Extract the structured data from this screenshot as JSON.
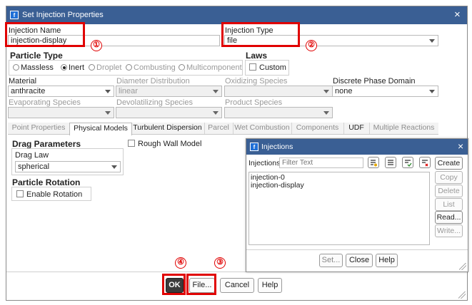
{
  "main_window": {
    "title": "Set Injection Properties",
    "close_glyph": "×",
    "app_icon_glyph": "f"
  },
  "injection_name": {
    "label": "Injection Name",
    "value": "injection-display"
  },
  "injection_type": {
    "label": "Injection Type",
    "value": "file"
  },
  "particle_type": {
    "label": "Particle Type",
    "options": [
      "Massless",
      "Inert",
      "Droplet",
      "Combusting",
      "Multicomponent"
    ],
    "selected": "Inert"
  },
  "laws": {
    "label": "Laws",
    "custom_label": "Custom"
  },
  "material": {
    "label": "Material",
    "value": "anthracite"
  },
  "diameter_distribution": {
    "label": "Diameter Distribution",
    "value": "linear"
  },
  "oxidizing_species": {
    "label": "Oxidizing Species",
    "value": ""
  },
  "discrete_phase_domain": {
    "label": "Discrete Phase Domain",
    "value": "none"
  },
  "evaporating_species": {
    "label": "Evaporating Species",
    "value": ""
  },
  "devolatilizing_species": {
    "label": "Devolatilizing Species",
    "value": ""
  },
  "product_species": {
    "label": "Product Species",
    "value": ""
  },
  "tabs": [
    "Point Properties",
    "Physical Models",
    "Turbulent Dispersion",
    "Parcel",
    "Wet Combustion",
    "Components",
    "UDF",
    "Multiple Reactions"
  ],
  "drag_parameters": {
    "label": "Drag Parameters",
    "drag_law_label": "Drag Law",
    "drag_law_value": "spherical"
  },
  "rough_wall_model": {
    "label": "Rough Wall Model"
  },
  "particle_rotation": {
    "label": "Particle Rotation",
    "enable_label": "Enable Rotation"
  },
  "bottom_buttons": {
    "ok": "OK",
    "file": "File...",
    "cancel": "Cancel",
    "help": "Help"
  },
  "injections_dialog": {
    "title": "Injections",
    "filter_label": "Injections",
    "filter_placeholder": "Filter Text",
    "items": [
      "injection-0",
      "injection-display"
    ],
    "side_buttons": [
      "Create",
      "Copy",
      "Delete",
      "List",
      "Read...",
      "Write..."
    ],
    "bottom_buttons": {
      "set": "Set...",
      "close": "Close",
      "help": "Help"
    }
  },
  "callouts": [
    "①",
    "②",
    "③",
    "④"
  ],
  "colors": {
    "titlebar": "#3a5f94",
    "callout_red": "#e00000",
    "ok_button": "#3b3b3b"
  }
}
